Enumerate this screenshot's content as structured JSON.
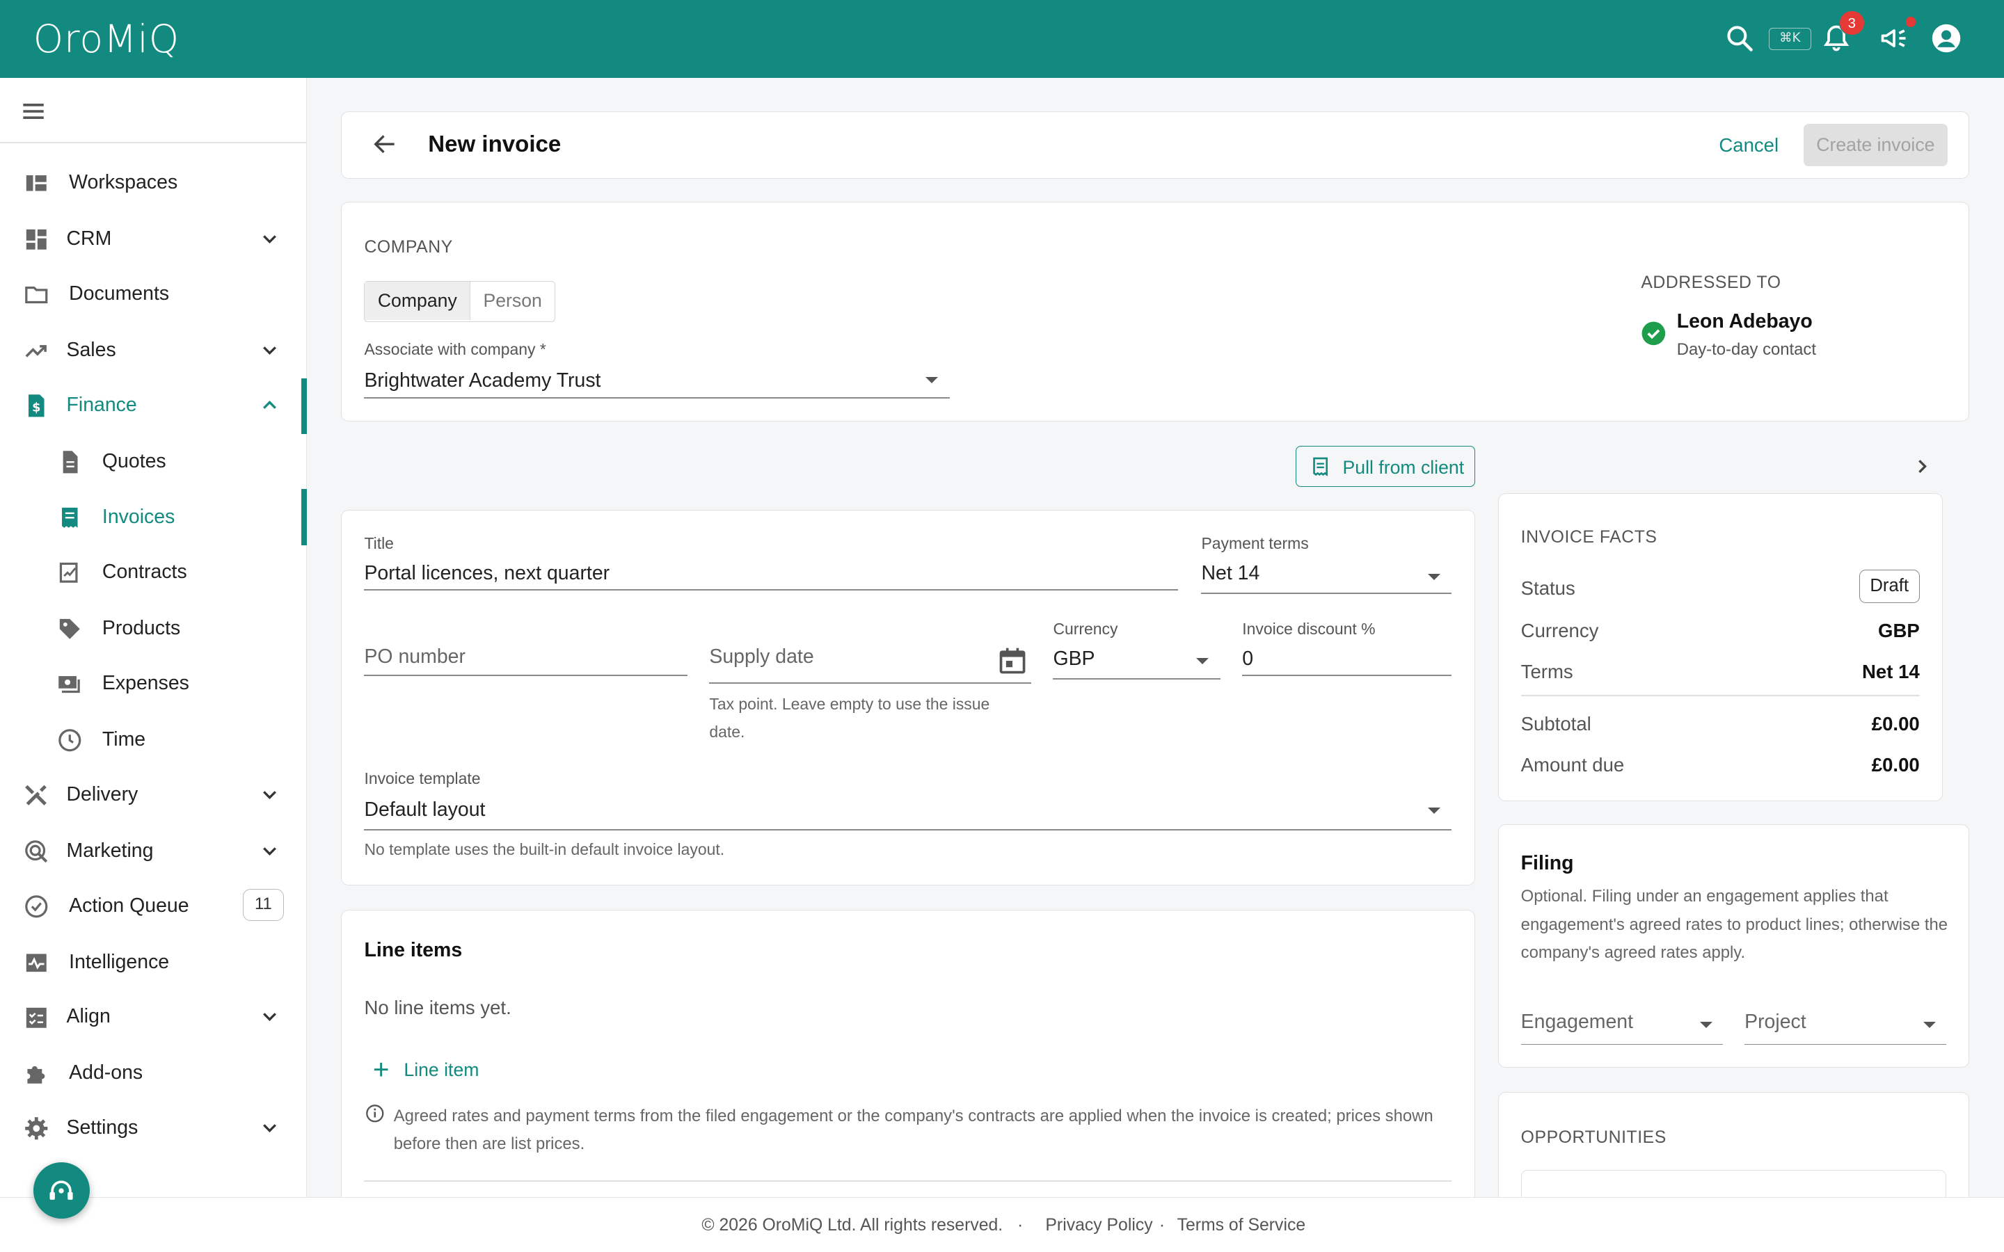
{
  "app": {
    "brand": "OroMiQ",
    "shortcut": "⌘K",
    "notifications_count": "3",
    "accent": "#138a80"
  },
  "sidebar": {
    "items": [
      {
        "label": "Workspaces",
        "icon": "workspaces-icon"
      },
      {
        "label": "CRM",
        "icon": "dashboard-icon"
      },
      {
        "label": "Documents",
        "icon": "folder-icon"
      },
      {
        "label": "Sales",
        "icon": "trending-up-icon"
      },
      {
        "label": "Finance",
        "icon": "finance-icon"
      },
      {
        "label": "Quotes",
        "icon": "document-icon"
      },
      {
        "label": "Invoices",
        "icon": "receipt-icon"
      },
      {
        "label": "Contracts",
        "icon": "contract-icon"
      },
      {
        "label": "Products",
        "icon": "tag-icon"
      },
      {
        "label": "Expenses",
        "icon": "payments-icon"
      },
      {
        "label": "Time",
        "icon": "clock-icon"
      },
      {
        "label": "Delivery",
        "icon": "tools-icon"
      },
      {
        "label": "Marketing",
        "icon": "campaign-icon"
      },
      {
        "label": "Action Queue",
        "icon": "check-circle-icon",
        "count": "11"
      },
      {
        "label": "Intelligence",
        "icon": "monitoring-icon"
      },
      {
        "label": "Align",
        "icon": "checklist-icon"
      },
      {
        "label": "Add-ons",
        "icon": "puzzle-icon"
      },
      {
        "label": "Settings",
        "icon": "gear-icon"
      }
    ]
  },
  "header": {
    "title": "New invoice",
    "cancel": "Cancel",
    "create": "Create invoice"
  },
  "company": {
    "section_label": "COMPANY",
    "toggle_company": "Company",
    "toggle_person": "Person",
    "associate_label": "Associate with company *",
    "associate_value": "Brightwater Academy Trust",
    "addressed_label": "ADDRESSED TO",
    "contact_name": "Leon Adebayo",
    "contact_role": "Day-to-day contact"
  },
  "pull_button": "Pull from client",
  "form": {
    "title_label": "Title",
    "title_value": "Portal licences, next quarter",
    "terms_label": "Payment terms",
    "terms_value": "Net 14",
    "po_placeholder": "PO number",
    "supply_placeholder": "Supply date",
    "supply_helper": "Tax point. Leave empty to use the issue date.",
    "currency_label": "Currency",
    "currency_value": "GBP",
    "discount_label": "Invoice discount %",
    "discount_value": "0",
    "template_label": "Invoice template",
    "template_value": "Default layout",
    "template_helper": "No template uses the built-in default invoice layout."
  },
  "line_items": {
    "title": "Line items",
    "empty": "No line items yet.",
    "add": "Line item",
    "note": "Agreed rates and payment terms from the filed engagement or the company's contracts are applied when the invoice is created; prices shown before then are list prices."
  },
  "facts": {
    "title": "INVOICE FACTS",
    "status_label": "Status",
    "status_value": "Draft",
    "currency_label": "Currency",
    "currency_value": "GBP",
    "terms_label": "Terms",
    "terms_value": "Net 14",
    "subtotal_label": "Subtotal",
    "subtotal_value": "£0.00",
    "due_label": "Amount due",
    "due_value": "£0.00"
  },
  "filing": {
    "title": "Filing",
    "desc": "Optional. Filing under an engagement applies that engagement's agreed rates to product lines; otherwise the company's agreed rates apply.",
    "engagement_placeholder": "Engagement",
    "project_placeholder": "Project"
  },
  "opportunities": {
    "title": "OPPORTUNITIES"
  },
  "footer": {
    "copyright": "© 2026 OroMiQ Ltd. All rights reserved.",
    "sep": "·",
    "privacy": "Privacy Policy",
    "terms": "Terms of Service"
  }
}
